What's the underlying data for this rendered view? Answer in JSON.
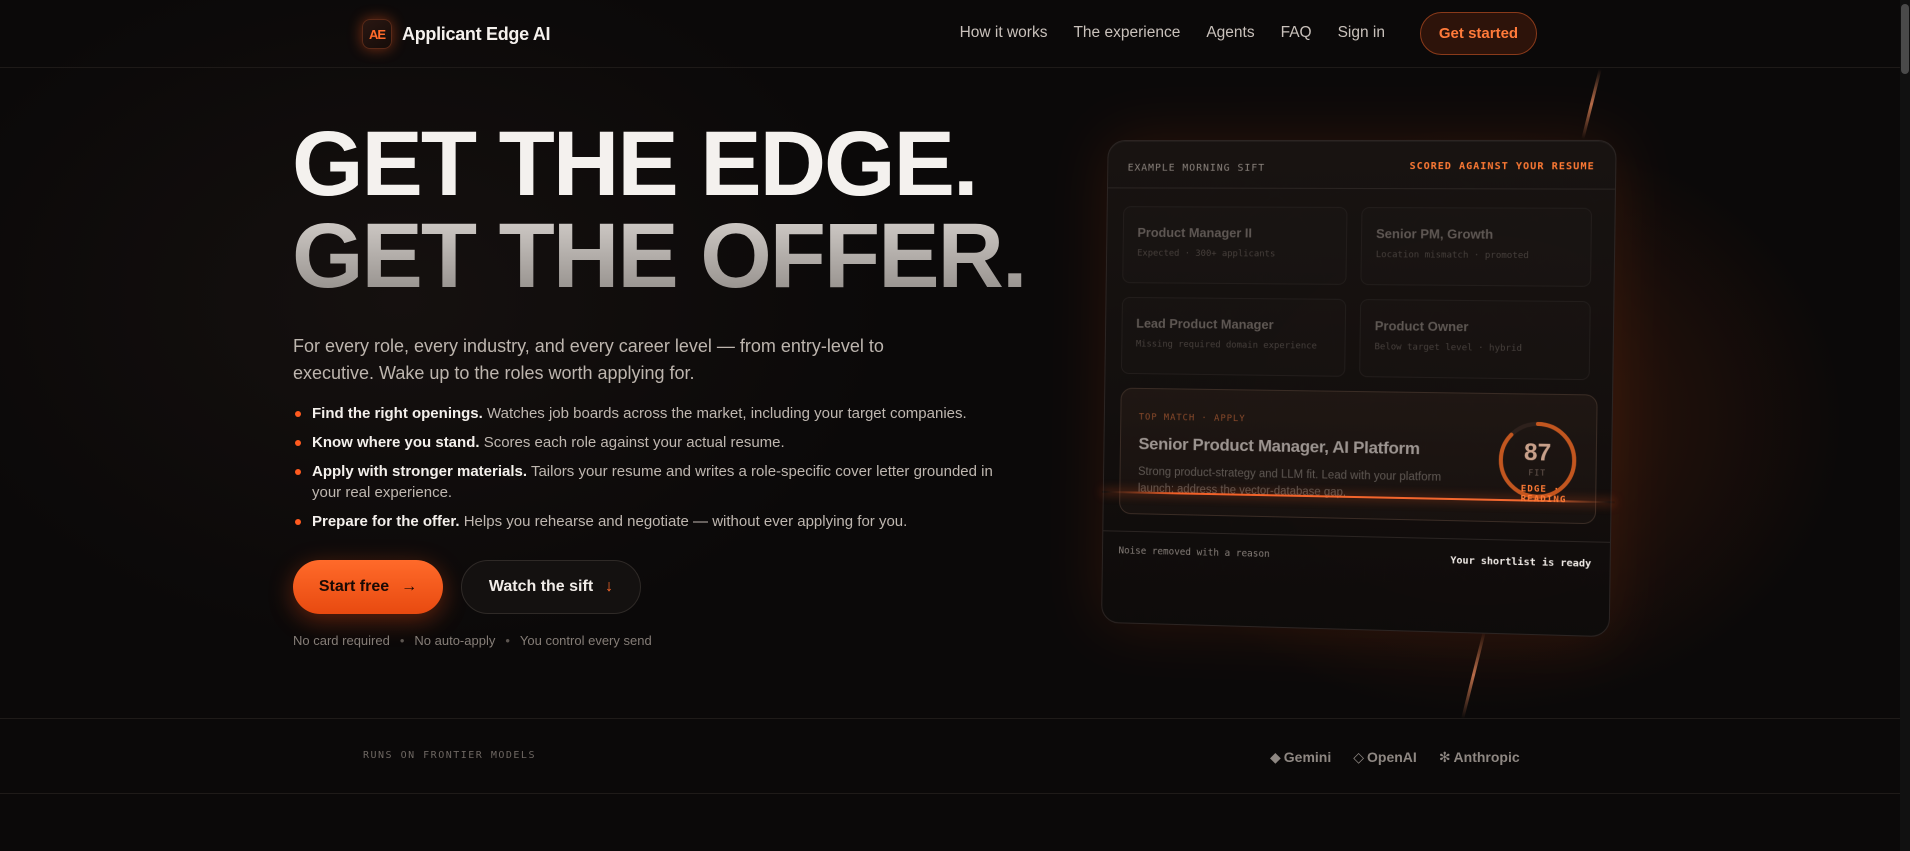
{
  "brand": {
    "mark": "AE",
    "name": "Applicant Edge AI"
  },
  "nav": {
    "links": [
      "How it works",
      "The experience",
      "Agents",
      "FAQ",
      "Sign in"
    ],
    "cta": "Get started"
  },
  "hero": {
    "line1": "GET THE EDGE.",
    "line2": "GET THE OFFER.",
    "lede": "For every role, every industry, and every career level — from entry-level to executive. Wake up to the roles worth applying for.",
    "bullets": [
      {
        "strong": "Find the right openings.",
        "text": " Watches job boards across the market, including your target companies."
      },
      {
        "strong": "Know where you stand.",
        "text": " Scores each role against your actual resume."
      },
      {
        "strong": "Apply with stronger materials.",
        "text": " Tailors your resume and writes a role-specific cover letter grounded in your real experience."
      },
      {
        "strong": "Prepare for the offer.",
        "text": " Helps you rehearse and negotiate — without ever applying for you."
      }
    ],
    "primary_cta": "Start free",
    "primary_arrow": "→",
    "secondary_cta": "Watch the sift",
    "secondary_arrow": "↓",
    "reassurances": [
      "No card required",
      "No auto-apply",
      "You control every send"
    ],
    "separator": "•"
  },
  "card": {
    "header_left": "EXAMPLE MORNING SIFT",
    "header_right": "SCORED AGAINST YOUR RESUME",
    "jobs": [
      {
        "title": "Product Manager II",
        "sub": "Expected · 300+ applicants"
      },
      {
        "title": "Senior PM, Growth",
        "sub": "Location mismatch · promoted"
      },
      {
        "title": "Lead Product Manager",
        "sub": "Missing required domain experience"
      },
      {
        "title": "Product Owner",
        "sub": "Below target level · hybrid"
      }
    ],
    "top_match": {
      "kicker": "TOP MATCH · APPLY",
      "title": "Senior Product Manager, AI Platform",
      "desc": "Strong product-strategy and LLM fit. Lead with your platform launch; address the vector-database gap.",
      "score": "87",
      "score_label": "FIT",
      "score_fraction": 0.87,
      "edge_tag": "EDGE · READING"
    },
    "footer_left": "Noise removed with a reason",
    "footer_right": "Your shortlist is ready"
  },
  "models": {
    "label": "RUNS ON FRONTIER MODELS",
    "items": [
      {
        "glyph": "◆",
        "name": "Gemini"
      },
      {
        "glyph": "◇",
        "name": "OpenAI"
      },
      {
        "glyph": "✻",
        "name": "Anthropic"
      }
    ]
  },
  "colors": {
    "accent": "#ff6a2a",
    "background": "#0b0909",
    "text": "#f4f1ee"
  }
}
